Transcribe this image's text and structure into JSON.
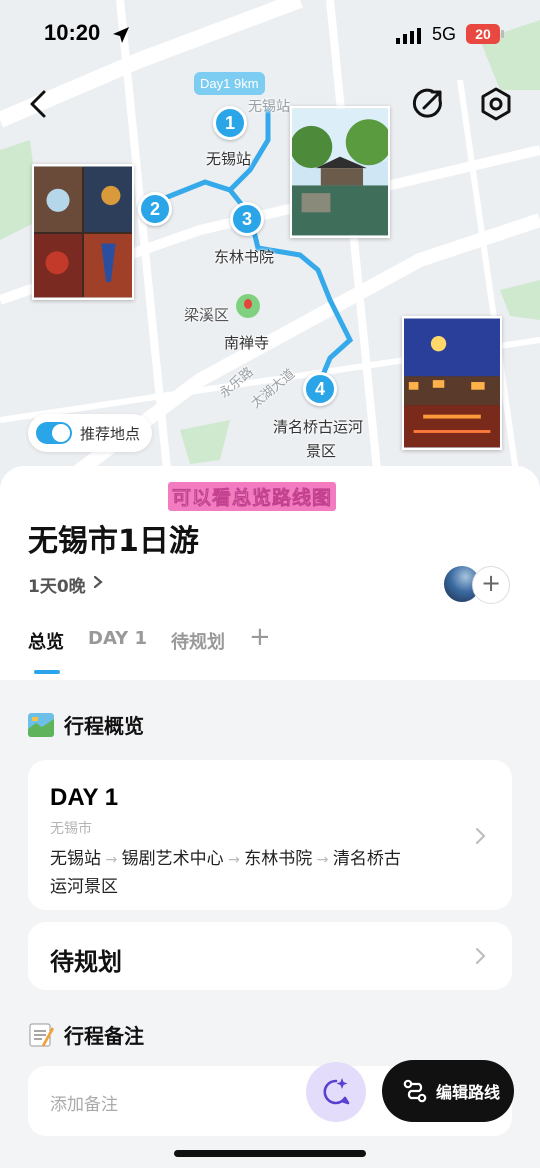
{
  "status_bar": {
    "time": "10:20",
    "network": "5G",
    "battery": "20"
  },
  "map": {
    "day_badge": "Day1 9km",
    "pins": [
      "1",
      "2",
      "3",
      "4"
    ],
    "labels": {
      "station_grey": "无锡站",
      "station": "无锡站",
      "donglin": "东林书院",
      "liangxi": "梁溪区",
      "nanchan": "南禅寺",
      "qingming_1": "清名桥古运河",
      "qingming_2": "景区",
      "road": "永乐路",
      "road2": "太湖大道"
    },
    "toggle_label": "推荐地点",
    "accent": "#2aa6e8"
  },
  "caption": "可以看总览路线图",
  "trip": {
    "title": "无锡市1日游",
    "duration": "1天0晚",
    "add_member": "+"
  },
  "tabs": [
    {
      "label": "总览",
      "active": true
    },
    {
      "label": "DAY 1"
    },
    {
      "label": "待规划"
    },
    {
      "label": "+"
    }
  ],
  "overview": {
    "heading": "行程概览",
    "day_card": {
      "title": "DAY 1",
      "city": "无锡市",
      "stops": [
        "无锡站",
        "锡剧艺术中心",
        "东林书院",
        "清名桥古",
        "运河景区"
      ]
    },
    "pending_card": {
      "title": "待规划"
    }
  },
  "notes": {
    "heading": "行程备注",
    "placeholder": "添加备注",
    "edit_button": "编辑路线"
  }
}
